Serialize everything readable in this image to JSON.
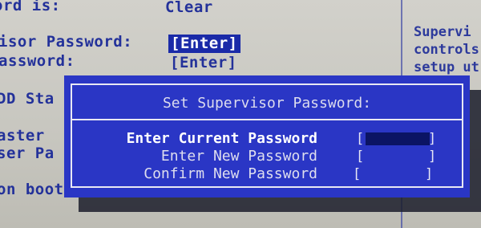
{
  "background": {
    "items": [
      {
        "name": "bg-line-status-label",
        "text": "ord is:"
      },
      {
        "name": "bg-line-status-value",
        "text": "Clear"
      },
      {
        "name": "bg-line-supervisor-label",
        "text": "isor Password:"
      },
      {
        "name": "bg-line-supervisor-value",
        "text": "[Enter]"
      },
      {
        "name": "bg-line-password-label",
        "text": "assword:"
      },
      {
        "name": "bg-line-password-value",
        "text": "[Enter]"
      },
      {
        "name": "bg-line-hdd",
        "text": "DD Sta"
      },
      {
        "name": "bg-line-master",
        "text": "aster"
      },
      {
        "name": "bg-line-user-pa",
        "text": "ser Pa"
      },
      {
        "name": "bg-line-on-boot",
        "text": "on boot"
      }
    ],
    "help_lines": [
      "Supervi",
      "controls",
      "setup ut"
    ]
  },
  "dialog": {
    "title": "Set Supervisor Password:",
    "rows": [
      {
        "label": "Enter Current Password",
        "active": true
      },
      {
        "label": "Enter New Password",
        "active": false
      },
      {
        "label": "Confirm New Password",
        "active": false
      }
    ]
  },
  "colors": {
    "dialog_bg": "#2a36c5",
    "screen_bg": "#c9c9c3",
    "text_blue": "#23319a",
    "highlight": "#1a2aa8"
  }
}
